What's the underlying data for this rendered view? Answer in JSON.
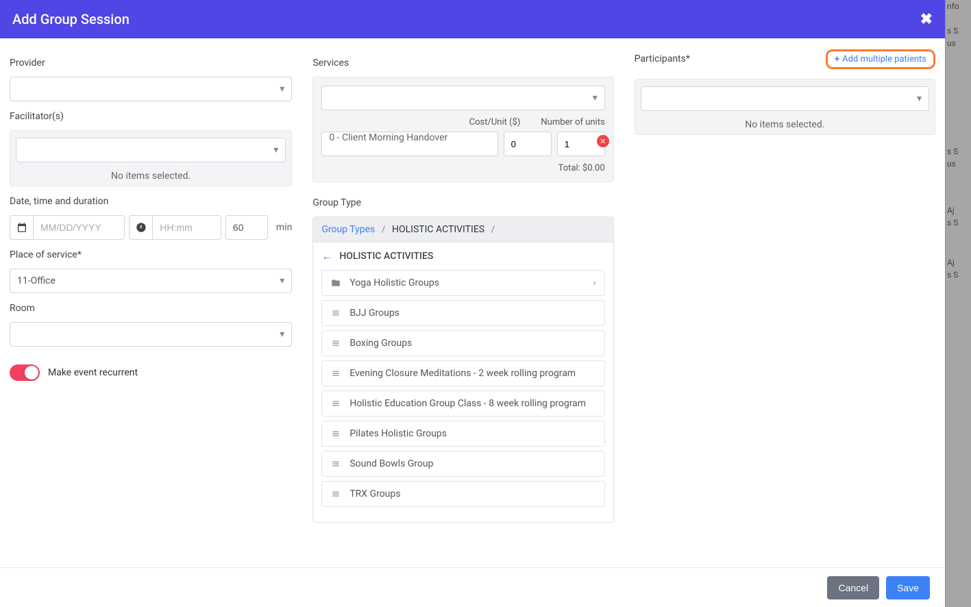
{
  "modal": {
    "title": "Add Group Session"
  },
  "left": {
    "provider_label": "Provider",
    "facilitators_label": "Facilitator(s)",
    "no_items": "No items selected.",
    "dt_label": "Date, time and duration",
    "date_placeholder": "MM/DD/YYYY",
    "time_placeholder": "HH:mm",
    "duration_value": "60",
    "min_unit": "min",
    "place_label": "Place of service*",
    "place_value": "11-Office",
    "room_label": "Room",
    "recurrent_label": "Make event recurrent"
  },
  "services": {
    "label": "Services",
    "cost_header": "Cost/Unit ($)",
    "units_header": "Number of units",
    "row_title": "0 - Client Morning Handover",
    "cost_value": "0",
    "units_value": "1",
    "total_label": "Total: $0.00"
  },
  "group_type": {
    "label": "Group Type",
    "crumb_root": "Group Types",
    "crumb_current": "HOLISTIC ACTIVITIES",
    "heading": "HOLISTIC ACTIVITIES",
    "items": [
      {
        "label": "Yoga Holistic Groups",
        "folder": true
      },
      {
        "label": "BJJ Groups",
        "folder": false
      },
      {
        "label": "Boxing Groups",
        "folder": false
      },
      {
        "label": "Evening Closure Meditations - 2 week rolling program",
        "folder": false
      },
      {
        "label": "Holistic Education Group Class - 8 week rolling program",
        "folder": false
      },
      {
        "label": "Pilates Holistic Groups",
        "folder": false
      },
      {
        "label": "Sound Bowls Group",
        "folder": false
      },
      {
        "label": "TRX Groups",
        "folder": false
      }
    ]
  },
  "participants": {
    "label": "Participants*",
    "add_multi": "Add multiple patients",
    "no_items": "No items selected."
  },
  "footer": {
    "cancel": "Cancel",
    "save": "Save"
  }
}
